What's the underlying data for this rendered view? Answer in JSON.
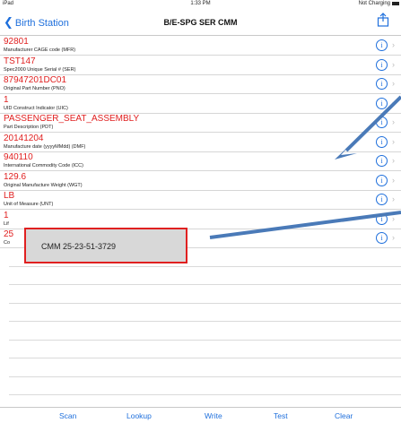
{
  "status_bar": {
    "carrier": "iPad",
    "time": "1:33 PM",
    "charging": "Not Charging"
  },
  "nav": {
    "back_label": "Birth Station",
    "title": "B/E-SPG SER CMM"
  },
  "rows": [
    {
      "value": "92801",
      "label": "Manufacturer CAGE code (MFR)"
    },
    {
      "value": "TST147",
      "label": "Spec2000 Unique Serial # (SER)"
    },
    {
      "value": "87947201DC01",
      "label": "Original Part Number (PNO)"
    },
    {
      "value": "1",
      "label": "UID Construct Indicator (UIC)"
    },
    {
      "value": "PASSENGER_SEAT_ASSEMBLY",
      "label": "Part Description (PDT)"
    },
    {
      "value": "20141204",
      "label": "Manufacture date (yyyyMMdd) (DMF)"
    },
    {
      "value": "940110",
      "label": "International Commodity Code (ICC)"
    },
    {
      "value": "129.6",
      "label": "Original Manufacture Weight (WGT)"
    },
    {
      "value": "LB",
      "label": "Unit of Measure (UNT)"
    },
    {
      "value": "1",
      "label": "Lif"
    },
    {
      "value": "25",
      "label": "Co"
    }
  ],
  "callout": {
    "text": "CMM   25-23-51-3729"
  },
  "tabs": [
    "Scan",
    "Lookup",
    "Write",
    "Test",
    "Clear"
  ],
  "colors": {
    "accent": "#1e6fdc",
    "value": "#e02020",
    "callout_border": "#e02020",
    "arrow": "#4a7ab8"
  }
}
